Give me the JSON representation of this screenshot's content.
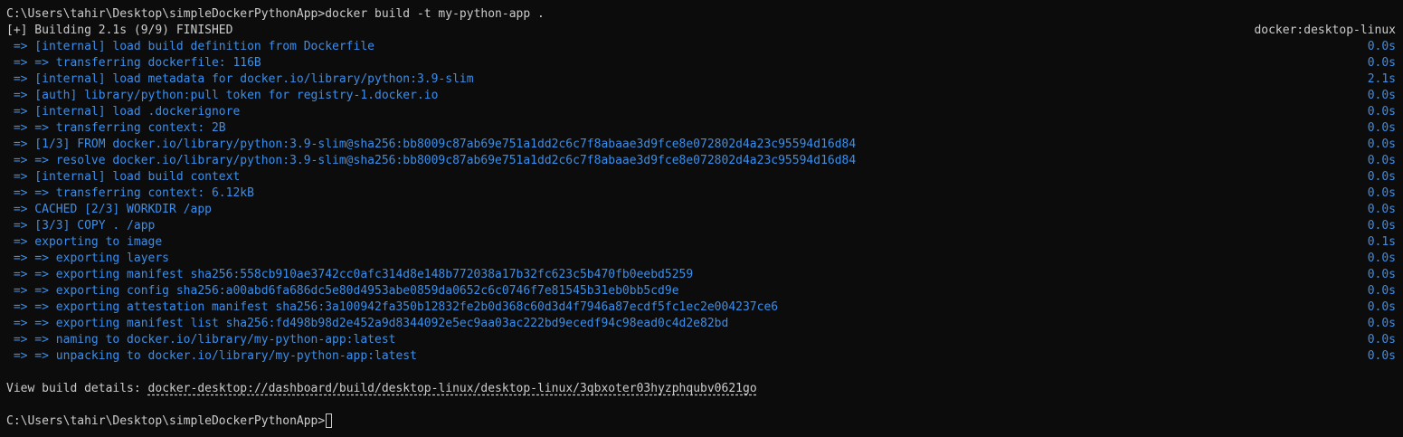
{
  "terminal": {
    "command_line": {
      "prompt": "C:\\Users\\tahir\\Desktop\\simpleDockerPythonApp>",
      "command": "docker build -t my-python-app ."
    },
    "header": {
      "status": "[+] Building 2.1s (9/9) FINISHED",
      "context": "docker:desktop-linux"
    },
    "steps": [
      {
        "text": " => [internal] load build definition from Dockerfile",
        "time": "0.0s"
      },
      {
        "text": " => => transferring dockerfile: 116B",
        "time": "0.0s"
      },
      {
        "text": " => [internal] load metadata for docker.io/library/python:3.9-slim",
        "time": "2.1s"
      },
      {
        "text": " => [auth] library/python:pull token for registry-1.docker.io",
        "time": "0.0s"
      },
      {
        "text": " => [internal] load .dockerignore",
        "time": "0.0s"
      },
      {
        "text": " => => transferring context: 2B",
        "time": "0.0s"
      },
      {
        "text": " => [1/3] FROM docker.io/library/python:3.9-slim@sha256:bb8009c87ab69e751a1dd2c6c7f8abaae3d9fce8e072802d4a23c95594d16d84",
        "time": "0.0s"
      },
      {
        "text": " => => resolve docker.io/library/python:3.9-slim@sha256:bb8009c87ab69e751a1dd2c6c7f8abaae3d9fce8e072802d4a23c95594d16d84",
        "time": "0.0s"
      },
      {
        "text": " => [internal] load build context",
        "time": "0.0s"
      },
      {
        "text": " => => transferring context: 6.12kB",
        "time": "0.0s"
      },
      {
        "text": " => CACHED [2/3] WORKDIR /app",
        "time": "0.0s"
      },
      {
        "text": " => [3/3] COPY . /app",
        "time": "0.0s"
      },
      {
        "text": " => exporting to image",
        "time": "0.1s"
      },
      {
        "text": " => => exporting layers",
        "time": "0.0s"
      },
      {
        "text": " => => exporting manifest sha256:558cb910ae3742cc0afc314d8e148b772038a17b32fc623c5b470fb0eebd5259",
        "time": "0.0s"
      },
      {
        "text": " => => exporting config sha256:a00abd6fa686dc5e80d4953abe0859da0652c6c0746f7e81545b31eb0bb5cd9e",
        "time": "0.0s"
      },
      {
        "text": " => => exporting attestation manifest sha256:3a100942fa350b12832fe2b0d368c60d3d4f7946a87ecdf5fc1ec2e004237ce6",
        "time": "0.0s"
      },
      {
        "text": " => => exporting manifest list sha256:fd498b98d2e452a9d8344092e5ec9aa03ac222bd9ecedf94c98ead0c4d2e82bd",
        "time": "0.0s"
      },
      {
        "text": " => => naming to docker.io/library/my-python-app:latest",
        "time": "0.0s"
      },
      {
        "text": " => => unpacking to docker.io/library/my-python-app:latest",
        "time": "0.0s"
      }
    ],
    "details": {
      "label": "View build details: ",
      "link": "docker-desktop://dashboard/build/desktop-linux/desktop-linux/3qbxoter03hyzphqubv0621go"
    },
    "final_prompt": "C:\\Users\\tahir\\Desktop\\simpleDockerPythonApp>"
  }
}
